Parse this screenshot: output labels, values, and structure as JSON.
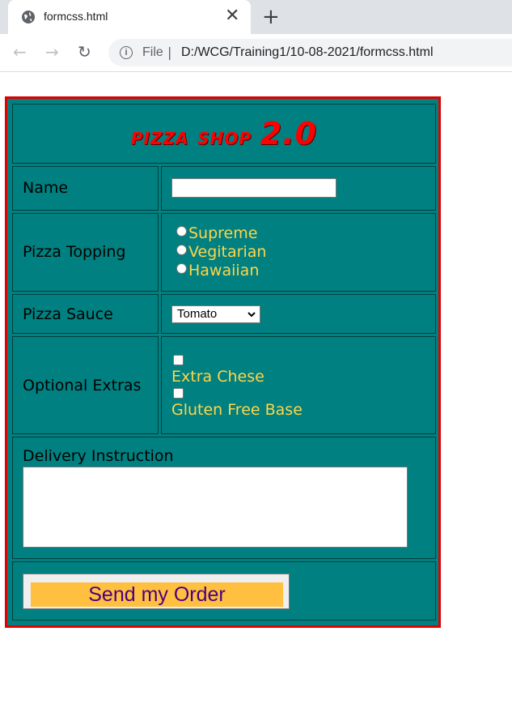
{
  "browser": {
    "tab_title": "formcss.html",
    "close_glyph": "✕",
    "new_tab_glyph": "+",
    "back_glyph": "←",
    "forward_glyph": "→",
    "reload_glyph": "↻",
    "info_glyph": "i",
    "scheme_label": "File",
    "separator": "|",
    "url": "D:/WCG/Training1/10-08-2021/formcss.html",
    "icons": [
      "globe-icon",
      "close-icon",
      "plus-icon",
      "back-arrow-icon",
      "forward-arrow-icon",
      "reload-icon",
      "info-icon"
    ]
  },
  "form": {
    "title_text": "pizza shop",
    "title_version": "2.0",
    "name_label": "Name",
    "name_value": "",
    "topping_label": "Pizza Topping",
    "toppings": [
      "Supreme",
      "Vegitarian",
      "Hawaiian"
    ],
    "sauce_label": "Pizza Sauce",
    "sauce_selected": "Tomato",
    "extras_label": "Optional Extras",
    "extras": [
      "Extra Chese",
      "Gluten Free Base"
    ],
    "delivery_label": "Delivery Instruction",
    "delivery_value": "",
    "submit_label": "Send my Order",
    "colors": {
      "background": "#008080",
      "border": "#e00000",
      "title": "#ff0000",
      "option_text": "#ffd54a",
      "button_bg": "#ffbf3f",
      "button_text": "#4b0082"
    }
  }
}
